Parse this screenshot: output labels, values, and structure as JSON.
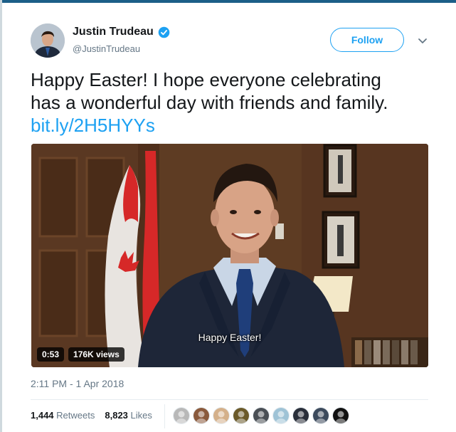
{
  "tweet": {
    "author_name": "Justin Trudeau",
    "author_handle": "@JustinTrudeau",
    "follow_label": "Follow",
    "text_line1": "Happy Easter! I hope everyone celebrating",
    "text_line2": "has a wonderful day with friends and family.",
    "link": "bit.ly/2H5HYYs",
    "timestamp": "2:11 PM - 1 Apr 2018"
  },
  "video": {
    "caption": "Happy Easter!",
    "duration": "0:53",
    "views": "176K views"
  },
  "stats": {
    "retweets_count": "1,444",
    "retweets_label": "Retweets",
    "likes_count": "8,823",
    "likes_label": "Likes"
  },
  "likers": [
    {
      "icon": "liker-avatar-1",
      "color": "#b8b8b8"
    },
    {
      "icon": "liker-avatar-2",
      "color": "#8a5a3c"
    },
    {
      "icon": "liker-avatar-3",
      "color": "#d4b08a"
    },
    {
      "icon": "liker-avatar-4",
      "color": "#6b5a2a"
    },
    {
      "icon": "liker-avatar-5",
      "color": "#4a4f55"
    },
    {
      "icon": "liker-avatar-6",
      "color": "#9fc3d6"
    },
    {
      "icon": "liker-avatar-7",
      "color": "#2a2f3a"
    },
    {
      "icon": "liker-avatar-8",
      "color": "#3c4a5c"
    },
    {
      "icon": "liker-avatar-9",
      "color": "#111111"
    }
  ],
  "colors": {
    "accent": "#1da1f2",
    "text_primary": "#14171a",
    "text_secondary": "#657786"
  }
}
